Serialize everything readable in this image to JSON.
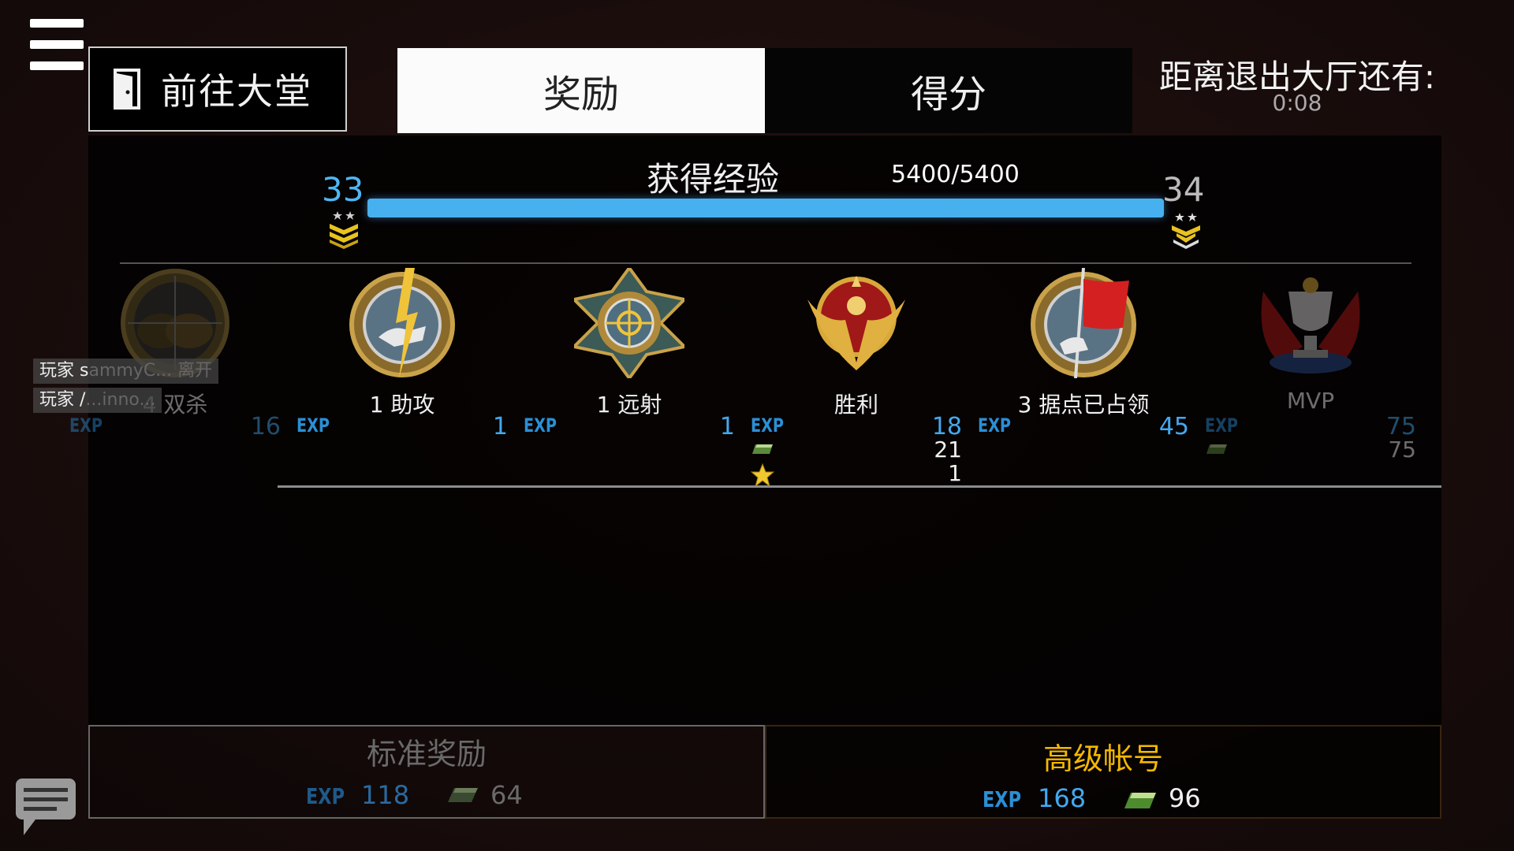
{
  "header": {
    "lobby_button": "前往大堂",
    "tabs": [
      {
        "label": "奖励",
        "active": true
      },
      {
        "label": "得分",
        "active": false
      }
    ],
    "timer_label": "距离退出大厅还有:",
    "timer_value": "0:08"
  },
  "experience": {
    "title": "获得经验",
    "progress_text": "5400/5400",
    "progress_fraction": 1.0,
    "level_from": "33",
    "level_to": "34"
  },
  "medals": [
    {
      "name": "double-kill",
      "label": "4 双杀",
      "exp_tag": "EXP",
      "exp": "16"
    },
    {
      "name": "assist",
      "label": "1 助攻",
      "exp_tag": "EXP",
      "exp": "1"
    },
    {
      "name": "long-range",
      "label": "1 远射",
      "exp_tag": "EXP",
      "exp": "1"
    },
    {
      "name": "victory",
      "label": "胜利",
      "exp_tag": "EXP",
      "exp": "18",
      "cash": "21",
      "stars": "1"
    },
    {
      "name": "capture",
      "label": "3 据点已占领",
      "exp_tag": "EXP",
      "exp": "45"
    },
    {
      "name": "mvp",
      "label": "MVP",
      "exp_tag": "EXP",
      "exp": "75",
      "cash": "75"
    }
  ],
  "notifications": [
    {
      "text": "玩家 s",
      "faded": "ammyC... 离开"
    },
    {
      "text": "玩家 /",
      "faded": "...inno..."
    }
  ],
  "standard_reward": {
    "title": "标准奖励",
    "exp_tag": "EXP",
    "exp": "118",
    "cash": "64"
  },
  "premium_account": {
    "title": "高级帐号",
    "exp_tag": "EXP",
    "exp": "168",
    "cash": "96"
  },
  "colors": {
    "accent_blue": "#47b0ef",
    "premium_gold": "#f5b800"
  },
  "icons": [
    "menu-icon",
    "door-icon",
    "chat-icon",
    "cash-icon",
    "star-icon",
    "rank-icon"
  ]
}
